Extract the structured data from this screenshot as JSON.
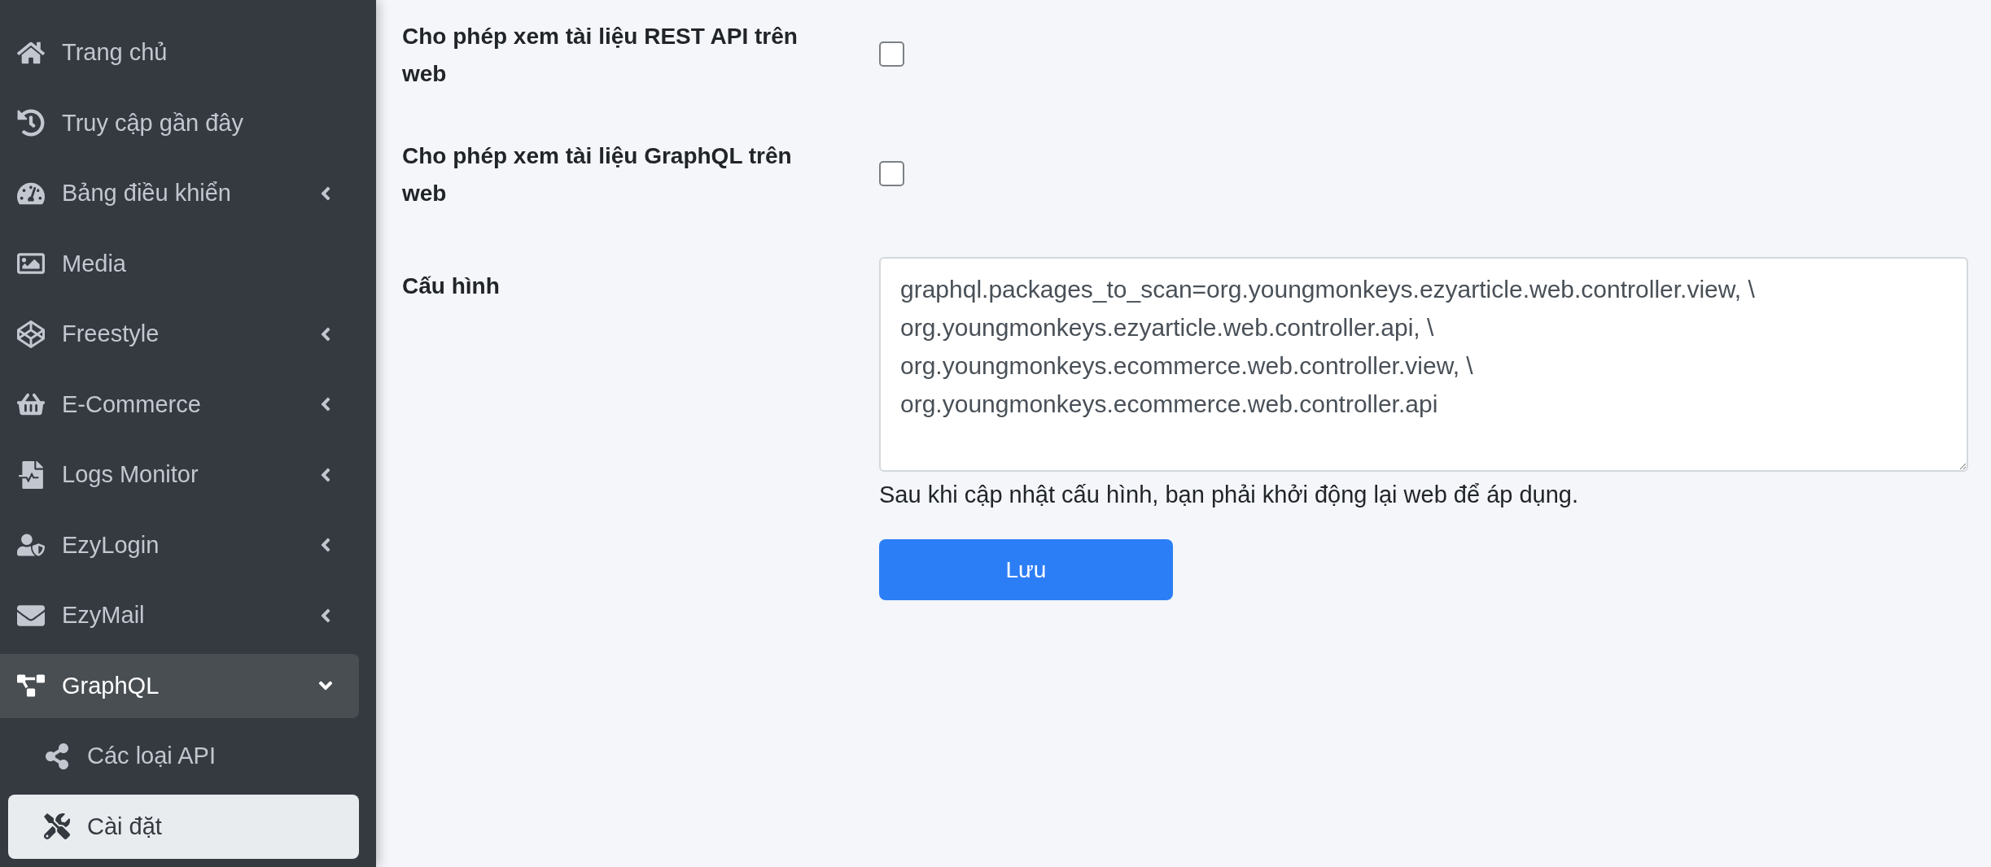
{
  "sidebar": {
    "items": [
      {
        "label": "Trang chủ",
        "has_submenu": false,
        "expanded": false
      },
      {
        "label": "Truy cập gần đây",
        "has_submenu": false,
        "expanded": false
      },
      {
        "label": "Bảng điều khiển",
        "has_submenu": true,
        "expanded": false
      },
      {
        "label": "Media",
        "has_submenu": false,
        "expanded": false
      },
      {
        "label": "Freestyle",
        "has_submenu": true,
        "expanded": false
      },
      {
        "label": "E-Commerce",
        "has_submenu": true,
        "expanded": false
      },
      {
        "label": "Logs Monitor",
        "has_submenu": true,
        "expanded": false
      },
      {
        "label": "EzyLogin",
        "has_submenu": true,
        "expanded": false
      },
      {
        "label": "EzyMail",
        "has_submenu": true,
        "expanded": false
      },
      {
        "label": "GraphQL",
        "has_submenu": true,
        "expanded": true,
        "children": [
          {
            "label": "Các loại API",
            "selected": false
          },
          {
            "label": "Cài đặt",
            "selected": true
          }
        ]
      }
    ]
  },
  "form": {
    "fields": [
      {
        "kind": "checkbox",
        "label": "Cho phép xem tài liệu REST API trên web",
        "checked": false
      },
      {
        "kind": "checkbox",
        "label": "Cho phép xem tài liệu GraphQL trên web",
        "checked": false
      },
      {
        "kind": "textarea",
        "label": "Cấu hình",
        "value": "graphql.packages_to_scan=org.youngmonkeys.ezyarticle.web.controller.view, \\\norg.youngmonkeys.ezyarticle.web.controller.api, \\\norg.youngmonkeys.ecommerce.web.controller.view, \\\norg.youngmonkeys.ecommerce.web.controller.api",
        "help": "Sau khi cập nhật cấu hình, bạn phải khởi động lại web để áp dụng."
      }
    ],
    "save_button": "Lưu"
  }
}
